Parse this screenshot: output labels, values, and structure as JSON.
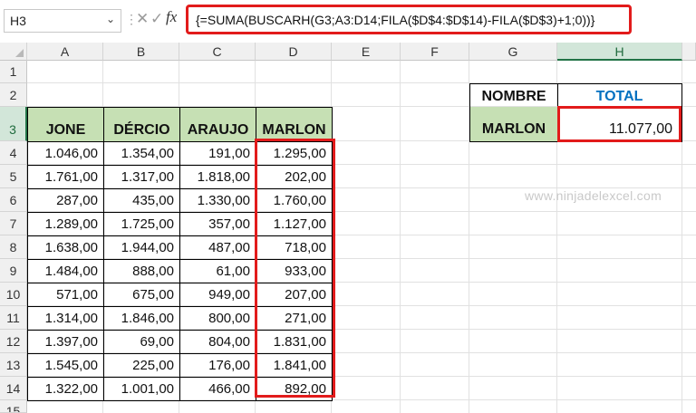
{
  "formula_bar": {
    "name_box": "H3",
    "formula": "{=SUMA(BUSCARH(G3;A3:D14;FILA($D$4:$D$14)-FILA($D$3)+1;0))}",
    "fx_label": "fx"
  },
  "columns": [
    "A",
    "B",
    "C",
    "D",
    "E",
    "F",
    "G",
    "H"
  ],
  "rows": [
    "1",
    "2",
    "3",
    "4",
    "5",
    "6",
    "7",
    "8",
    "9",
    "10",
    "11",
    "12",
    "13",
    "14",
    "15"
  ],
  "table": {
    "headers": [
      "JONE",
      "DÉRCIO",
      "ARAUJO",
      "MARLON"
    ],
    "data": [
      [
        "1.046,00",
        "1.354,00",
        "191,00",
        "1.295,00"
      ],
      [
        "1.761,00",
        "1.317,00",
        "1.818,00",
        "202,00"
      ],
      [
        "287,00",
        "435,00",
        "1.330,00",
        "1.760,00"
      ],
      [
        "1.289,00",
        "1.725,00",
        "357,00",
        "1.127,00"
      ],
      [
        "1.638,00",
        "1.944,00",
        "487,00",
        "718,00"
      ],
      [
        "1.484,00",
        "888,00",
        "61,00",
        "933,00"
      ],
      [
        "571,00",
        "675,00",
        "949,00",
        "207,00"
      ],
      [
        "1.314,00",
        "1.846,00",
        "800,00",
        "271,00"
      ],
      [
        "1.397,00",
        "69,00",
        "804,00",
        "1.831,00"
      ],
      [
        "1.545,00",
        "225,00",
        "176,00",
        "1.841,00"
      ],
      [
        "1.322,00",
        "1.001,00",
        "466,00",
        "892,00"
      ]
    ]
  },
  "lookup": {
    "nombre_label": "NOMBRE",
    "total_label": "TOTAL",
    "nombre_value": "MARLON",
    "total_value": "11.077,00"
  },
  "watermark": "www.ninjadelexcel.com",
  "colors": {
    "header_fill": "#c6e0b4",
    "highlight_red": "#e21b1b",
    "total_blue": "#0070c0"
  }
}
